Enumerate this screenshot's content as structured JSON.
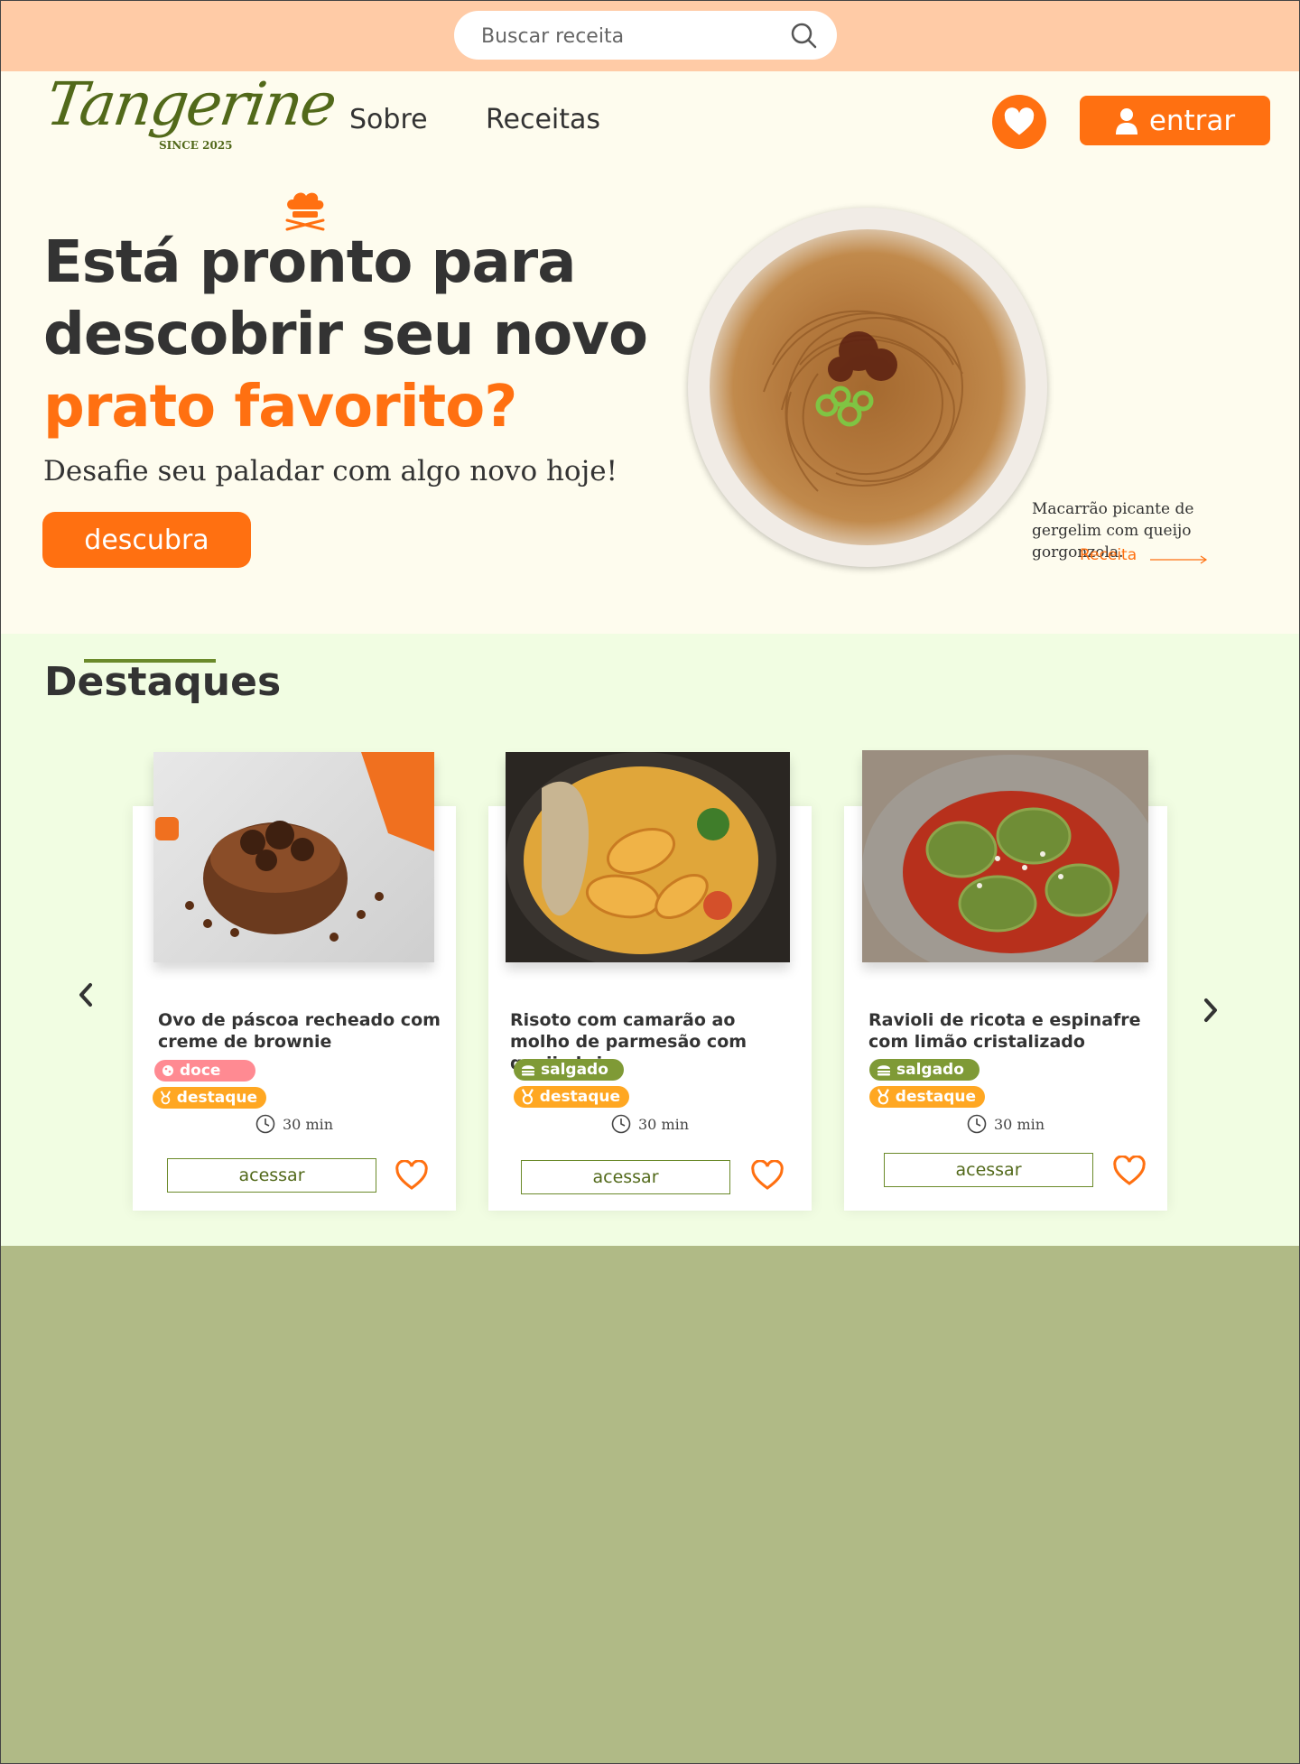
{
  "search": {
    "placeholder": "Buscar receita"
  },
  "brand": {
    "name": "Tangerine",
    "since": "SINCE 2025"
  },
  "nav": {
    "about": "Sobre",
    "recipes": "Receitas",
    "login": "entrar"
  },
  "hero": {
    "line1": "Está pronto para",
    "line2": "descobrir seu novo",
    "line3": "prato favorito?",
    "subtitle": "Desafie seu paladar com algo novo hoje!",
    "button": "descubra",
    "caption": "Macarrão picante de gergelim com queijo gorgonzola.",
    "caption_link": "Receita"
  },
  "highlights": {
    "title": "Destaques",
    "cards": [
      {
        "title": "Ovo de páscoa recheado com creme de brownie",
        "category": "doce",
        "badge": "destaque",
        "time": "30 min",
        "button": "acessar"
      },
      {
        "title": "Risoto com camarão ao molho de parmesão com queijo brie",
        "category": "salgado",
        "badge": "destaque",
        "time": "30 min",
        "button": "acessar"
      },
      {
        "title": "Ravioli de ricota e espinafre com limão cristalizado",
        "category": "salgado",
        "badge": "destaque",
        "time": "30 min",
        "button": "acessar"
      }
    ]
  },
  "colors": {
    "accent": "#ff7011",
    "brand_green": "#52691a",
    "topbar": "#ffcba6",
    "highlight_bg": "#f1fde2",
    "footer_bg": "#b0ba86"
  },
  "icons": [
    "search-icon",
    "chef-hat-icon",
    "heart-icon",
    "user-icon",
    "chevron-left-icon",
    "chevron-right-icon",
    "clock-icon",
    "cookie-icon",
    "burger-icon",
    "medal-icon"
  ]
}
